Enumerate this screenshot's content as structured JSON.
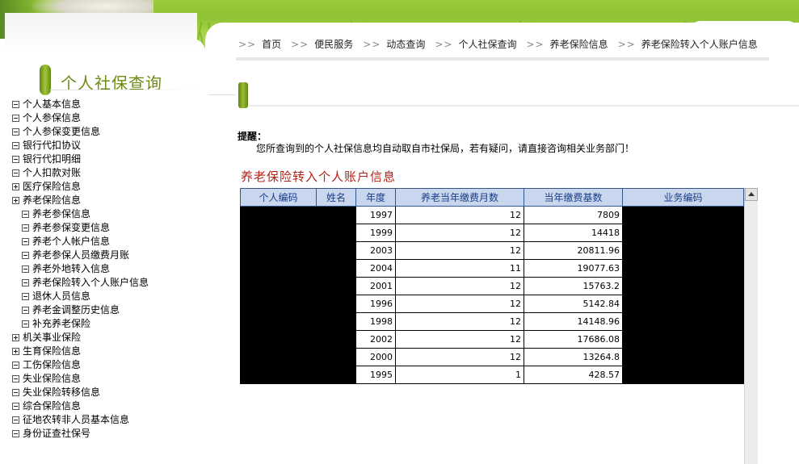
{
  "sidebar": {
    "title": "个人社保查询",
    "items": [
      {
        "label": "个人基本信息",
        "toggle": "minus",
        "level": 0
      },
      {
        "label": "个人参保信息",
        "toggle": "minus",
        "level": 0
      },
      {
        "label": "个人参保变更信息",
        "toggle": "minus",
        "level": 0
      },
      {
        "label": "银行代扣协议",
        "toggle": "minus",
        "level": 0
      },
      {
        "label": "银行代扣明细",
        "toggle": "minus",
        "level": 0
      },
      {
        "label": "个人扣款对账",
        "toggle": "minus",
        "level": 0
      },
      {
        "label": "医疗保险信息",
        "toggle": "plus",
        "level": 0
      },
      {
        "label": "养老保险信息",
        "toggle": "plus",
        "level": 0
      },
      {
        "label": "养老参保信息",
        "toggle": "minus",
        "level": 1
      },
      {
        "label": "养老参保变更信息",
        "toggle": "minus",
        "level": 1
      },
      {
        "label": "养老个人帐户信息",
        "toggle": "minus",
        "level": 1
      },
      {
        "label": "养老参保人员缴费月账",
        "toggle": "minus",
        "level": 1
      },
      {
        "label": "养老外地转入信息",
        "toggle": "minus",
        "level": 1
      },
      {
        "label": "养老保险转入个人账户信息",
        "toggle": "minus",
        "level": 1
      },
      {
        "label": "退休人员信息",
        "toggle": "minus",
        "level": 1
      },
      {
        "label": "养老金调整历史信息",
        "toggle": "minus",
        "level": 1
      },
      {
        "label": "补充养老保险",
        "toggle": "minus",
        "level": 1
      },
      {
        "label": "机关事业保险",
        "toggle": "plus",
        "level": 0
      },
      {
        "label": "生育保险信息",
        "toggle": "plus",
        "level": 0
      },
      {
        "label": "工伤保险信息",
        "toggle": "minus",
        "level": 0
      },
      {
        "label": "失业保险信息",
        "toggle": "minus",
        "level": 0
      },
      {
        "label": "失业保险转移信息",
        "toggle": "minus",
        "level": 0
      },
      {
        "label": "综合保险信息",
        "toggle": "minus",
        "level": 0
      },
      {
        "label": "征地农转非人员基本信息",
        "toggle": "minus",
        "level": 0
      },
      {
        "label": "身份证查社保号",
        "toggle": "minus",
        "level": 0
      }
    ]
  },
  "breadcrumb": {
    "separator": ">>",
    "items": [
      "首页",
      "便民服务",
      "动态查询",
      "个人社保查询",
      "养老保险信息",
      "养老保险转入个人账户信息"
    ]
  },
  "notice": {
    "label": "提醒：",
    "text": "您所查询到的个人社保信息均自动取自市社保局，若有疑问，请直接咨询相关业务部门！"
  },
  "table": {
    "title": "养老保险转入个人账户信息",
    "columns": [
      "个人编码",
      "姓名",
      "年度",
      "养老当年缴费月数",
      "当年缴费基数",
      "业务编码"
    ],
    "rows": [
      {
        "year": "1997",
        "months": "12",
        "base": "7809"
      },
      {
        "year": "1999",
        "months": "12",
        "base": "14418"
      },
      {
        "year": "2003",
        "months": "12",
        "base": "20811.96"
      },
      {
        "year": "2004",
        "months": "11",
        "base": "19077.63"
      },
      {
        "year": "2001",
        "months": "12",
        "base": "15763.2"
      },
      {
        "year": "1996",
        "months": "12",
        "base": "5142.84"
      },
      {
        "year": "1998",
        "months": "12",
        "base": "14148.96"
      },
      {
        "year": "2002",
        "months": "12",
        "base": "17686.08"
      },
      {
        "year": "2000",
        "months": "12",
        "base": "13264.8"
      },
      {
        "year": "1995",
        "months": "1",
        "base": "428.57"
      }
    ]
  },
  "colors": {
    "accent_green": "#6d8b12",
    "title_red": "#b52218",
    "header_bg": "#c9d7ee",
    "header_text": "#1a3d86"
  }
}
